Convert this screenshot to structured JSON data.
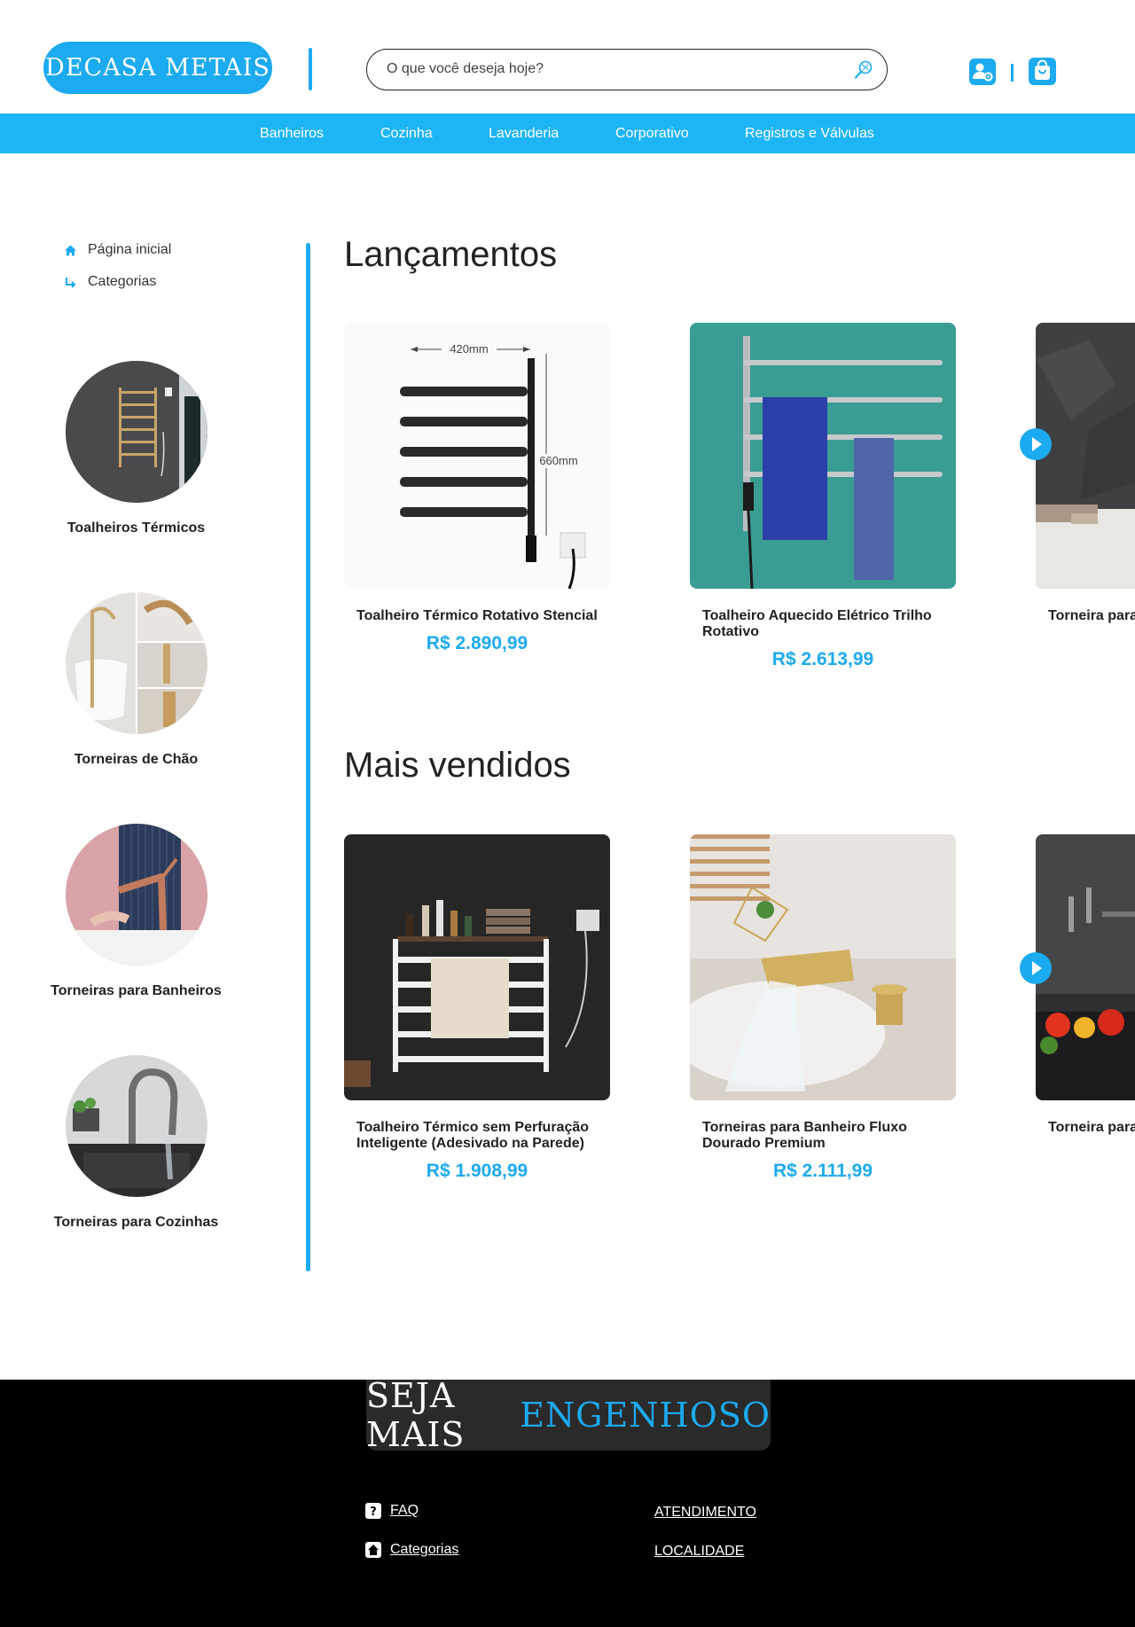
{
  "header": {
    "logo_text": "DECASA METAIS",
    "search_placeholder": "O que você deseja hoje?"
  },
  "nav": {
    "items": [
      "Banheiros",
      "Cozinha",
      "Lavanderia",
      "Corporativo",
      "Registros e Válvulas"
    ]
  },
  "breadcrumb": {
    "home": "Página inicial",
    "categories": "Categorias"
  },
  "categories": [
    "Toalheiros Térmicos",
    "Torneiras de Chão",
    "Torneiras para Banheiros",
    "Torneiras para Cozinhas"
  ],
  "launches": {
    "title": "Lançamentos",
    "products": [
      {
        "name": "Toalheiro Térmico Rotativo Stencial",
        "price": "R$ 2.890,99",
        "dim_width": "420mm",
        "dim_height": "660mm"
      },
      {
        "name": "Toalheiro Aquecido Elétrico Trilho Rotativo",
        "price": "R$ 2.613,99"
      },
      {
        "name": "Torneira para"
      }
    ]
  },
  "best_sellers": {
    "title": "Mais vendidos",
    "products": [
      {
        "name": "Toalheiro Térmico sem Perfuração Inteligente (Adesivado na Parede)",
        "price": "R$ 1.908,99"
      },
      {
        "name": "Torneiras para Banheiro Fluxo Dourado Premium",
        "price": "R$ 2.111,99"
      },
      {
        "name": "Torneira para"
      }
    ]
  },
  "footer": {
    "slogan_a": "SEJA MAIS",
    "slogan_b": "ENGENHOSO",
    "links": {
      "faq": "FAQ",
      "categories": "Categorias",
      "service": "ATENDIMENTO",
      "location": "LOCALIDADE"
    }
  },
  "colors": {
    "accent": "#1caaf0",
    "nav": "#1db5f5",
    "footer": "#000000"
  }
}
